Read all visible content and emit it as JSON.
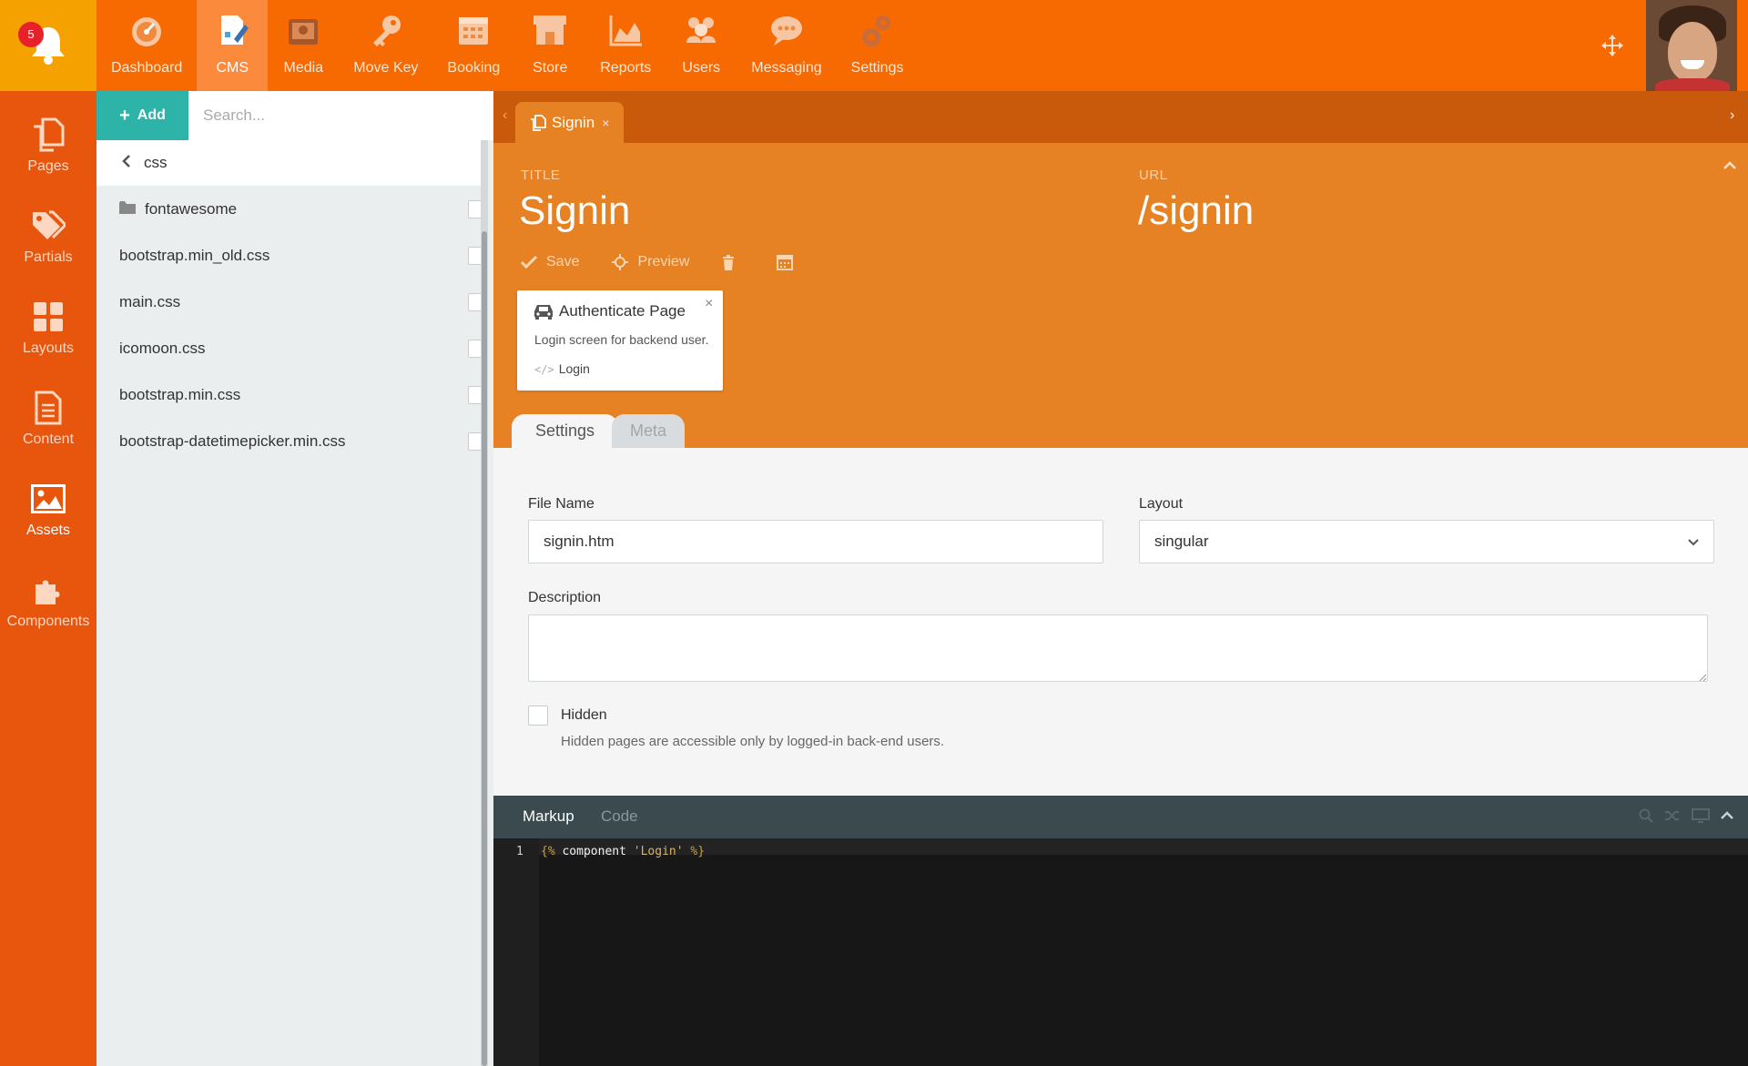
{
  "notifications": {
    "count": "5",
    "icon": "bell-icon"
  },
  "nav": [
    {
      "label": "Dashboard",
      "icon": "dashboard-icon",
      "active": false
    },
    {
      "label": "CMS",
      "icon": "cms-icon",
      "active": true
    },
    {
      "label": "Media",
      "icon": "media-icon",
      "active": false
    },
    {
      "label": "Move Key",
      "icon": "key-icon",
      "active": false
    },
    {
      "label": "Booking",
      "icon": "calendar-icon",
      "active": false
    },
    {
      "label": "Store",
      "icon": "store-icon",
      "active": false
    },
    {
      "label": "Reports",
      "icon": "chart-icon",
      "active": false
    },
    {
      "label": "Users",
      "icon": "users-icon",
      "active": false
    },
    {
      "label": "Messaging",
      "icon": "chat-icon",
      "active": false
    },
    {
      "label": "Settings",
      "icon": "gears-icon",
      "active": false
    }
  ],
  "sidebar": {
    "items": [
      {
        "label": "Pages",
        "icon": "pages-icon",
        "active": false
      },
      {
        "label": "Partials",
        "icon": "tags-icon",
        "active": false
      },
      {
        "label": "Layouts",
        "icon": "layouts-icon",
        "active": false
      },
      {
        "label": "Content",
        "icon": "content-icon",
        "active": false
      },
      {
        "label": "Assets",
        "icon": "image-icon",
        "active": true
      },
      {
        "label": "Components",
        "icon": "puzzle-icon",
        "active": false
      }
    ]
  },
  "file_panel": {
    "add_label": "Add",
    "search_placeholder": "Search...",
    "current_folder": "css",
    "files": [
      {
        "name": "fontawesome",
        "is_folder": true
      },
      {
        "name": "bootstrap.min_old.css",
        "is_folder": false
      },
      {
        "name": "main.css",
        "is_folder": false
      },
      {
        "name": "icomoon.css",
        "is_folder": false
      },
      {
        "name": "bootstrap.min.css",
        "is_folder": false
      },
      {
        "name": "bootstrap-datetimepicker.min.css",
        "is_folder": false
      }
    ]
  },
  "editor": {
    "tab_label": "Signin",
    "title_caption": "TITLE",
    "title_value": "Signin",
    "url_caption": "URL",
    "url_value": "/signin",
    "toolbar": {
      "save_label": "Save",
      "preview_label": "Preview"
    },
    "component": {
      "title": "Authenticate Page",
      "description": "Login screen for backend user.",
      "alias": "Login"
    },
    "tabs": [
      {
        "label": "Settings",
        "active": true
      },
      {
        "label": "Meta",
        "active": false
      }
    ],
    "form": {
      "file_name_label": "File Name",
      "file_name_value": "signin.htm",
      "layout_label": "Layout",
      "layout_value": "singular",
      "description_label": "Description",
      "description_value": "",
      "hidden_label": "Hidden",
      "hidden_checked": false,
      "hidden_help": "Hidden pages are accessible only by logged-in back-end users."
    }
  },
  "code_editor": {
    "tabs": [
      {
        "label": "Markup",
        "active": true
      },
      {
        "label": "Code",
        "active": false
      }
    ],
    "line_number": "1",
    "line_tokens": {
      "open": "{%",
      "keyword": "component",
      "string": "'Login'",
      "close": "%}"
    }
  },
  "colors": {
    "topbar": "#f76a02",
    "bell_box": "#f5a100",
    "sidebar": "#e8560e",
    "header": "#e68124",
    "tabstrip": "#c9590b",
    "add_button": "#2eb3a8",
    "code_bg": "#171717"
  }
}
